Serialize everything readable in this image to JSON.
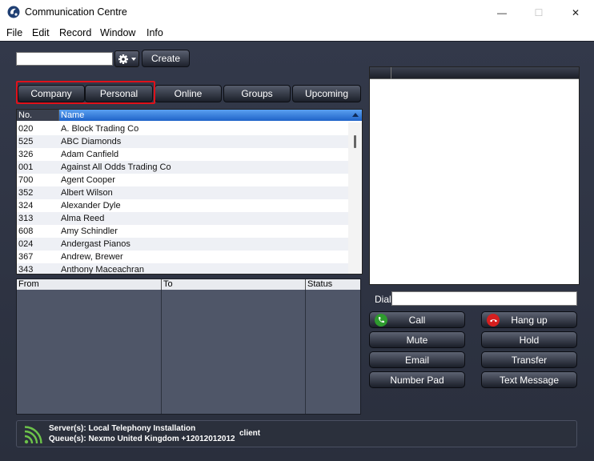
{
  "window": {
    "title": "Communication Centre",
    "controls": {
      "minimize": "—",
      "maximize": "☐",
      "close": "✕"
    }
  },
  "menu": [
    "File",
    "Edit",
    "Record",
    "Window",
    "Info"
  ],
  "toolbar": {
    "search_value": "",
    "gear_icon": "gear-icon",
    "create_label": "Create"
  },
  "tabs": [
    "Company",
    "Personal",
    "Online",
    "Groups",
    "Upcoming"
  ],
  "contacts": {
    "columns": [
      "No.",
      "Name"
    ],
    "rows": [
      [
        "020",
        "A. Block Trading Co"
      ],
      [
        "525",
        "ABC Diamonds"
      ],
      [
        "326",
        "Adam Canfield"
      ],
      [
        "001",
        "Against All Odds Trading Co"
      ],
      [
        "700",
        "Agent Cooper"
      ],
      [
        "352",
        "Albert Wilson"
      ],
      [
        "324",
        "Alexander Dyle"
      ],
      [
        "313",
        "Alma Reed"
      ],
      [
        "608",
        "Amy Schindler"
      ],
      [
        "024",
        "Andergast Pianos"
      ],
      [
        "367",
        "Andrew, Brewer"
      ],
      [
        "343",
        "Anthony Maceachran"
      ]
    ]
  },
  "calls": {
    "columns": [
      "From",
      "To",
      "Status"
    ]
  },
  "dial": {
    "label": "Dial",
    "value": ""
  },
  "actions": {
    "call": "Call",
    "hangup": "Hang up",
    "mute": "Mute",
    "hold": "Hold",
    "email": "Email",
    "transfer": "Transfer",
    "numpad": "Number Pad",
    "text": "Text Message"
  },
  "colors": {
    "call_green": "#2e9b2e",
    "hangup_red": "#d61f1f",
    "signal_green": "#6cc24a",
    "highlight_red": "#e0111a"
  },
  "status": {
    "server": "Server(s): Local Telephony Installation",
    "queue": "Queue(s): Nexmo United Kingdom +12012012012",
    "client": "client"
  }
}
